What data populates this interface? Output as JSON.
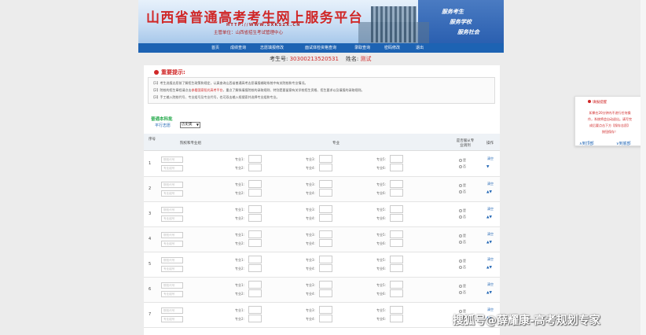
{
  "header": {
    "title": "山西省普通高考考生网上服务平台",
    "url": "HTTP://WWW.SXKSZX.CN",
    "org": "主管单位：山西省招生考试管理中心",
    "slogans": [
      "服务考生",
      "服务学校",
      "服务社会"
    ]
  },
  "nav": [
    "首页",
    "成绩查询",
    "志愿填报修改",
    "面试体检资格查询",
    "录取查询",
    "密码修改",
    "退出"
  ],
  "examinee": {
    "number_label": "考生号:",
    "number": "30300213520531",
    "name_label": "姓名:",
    "name": "测试"
  },
  "notice": {
    "title": "重要提示:",
    "lines": [
      "【1】考生选报志愿前了解招生政策和规定，认真查询山西省普通高考志愿填报辅助系统中有关院校和专业情况。",
      "【2】院校的招生章程请点击",
      "参看国家阳光高考平台",
      "，重点了解拟填报院校的录取规则、特别是要留意有关学校招生资格、招生要求以及填报的录取规则。",
      "【3】手工输入院校代号、专业组号及专业代号，也可双击输入框搜索并选择专业组和专业。"
    ]
  },
  "batch": {
    "name": "普通本科批",
    "choice_label": "平行志愿",
    "select_value": "历史类"
  },
  "table": {
    "headers": [
      "序号",
      "院校和专业组",
      "专业",
      "是否服从专业调剂",
      "操作"
    ],
    "institution_placeholder": "院校代号",
    "group_placeholder": "专业组号",
    "major_labels": [
      "专业1:",
      "专业2:",
      "专业3:",
      "专业4:",
      "专业5:",
      "专业6:"
    ],
    "radio_yes": "是",
    "radio_no": "否",
    "op_clear": "清空",
    "rows": [
      {
        "no": "1",
        "arrows": "▼"
      },
      {
        "no": "2",
        "arrows": "▲▼"
      },
      {
        "no": "3",
        "arrows": "▲▼"
      },
      {
        "no": "4",
        "arrows": "▲▼"
      },
      {
        "no": "5",
        "arrows": "▲▼"
      },
      {
        "no": "6",
        "arrows": "▲▼"
      },
      {
        "no": "7",
        "arrows": "▲▼"
      }
    ]
  },
  "popup": {
    "title": "填报提醒",
    "body": [
      "如果在20分钟内不进行任何操",
      "作，系统将会自动退出。请写完",
      "成后要点击下方【保存志愿】",
      "按钮保存！"
    ],
    "to_top": "∧到顶部",
    "to_bottom": "∨到底部"
  },
  "watermark": "搜狐号@薛耀康-高考规划专家",
  "colors": {
    "nav": "#1d63b3",
    "title_red": "#d02727",
    "batch_green": "#23a94a"
  }
}
